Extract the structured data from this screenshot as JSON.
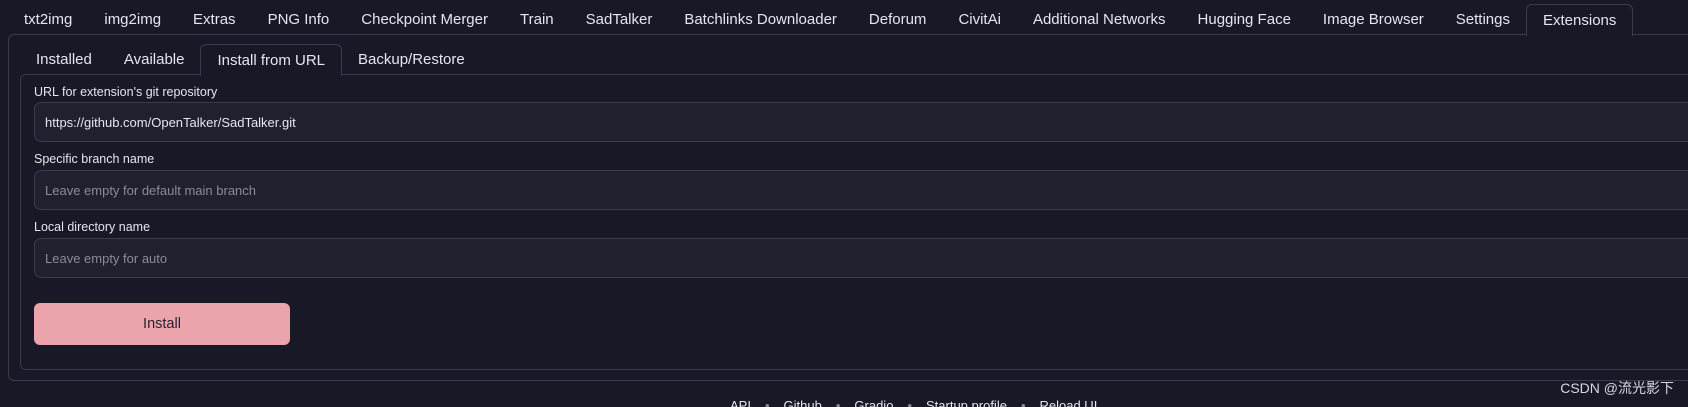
{
  "top_tabs": [
    {
      "label": "txt2img"
    },
    {
      "label": "img2img"
    },
    {
      "label": "Extras"
    },
    {
      "label": "PNG Info"
    },
    {
      "label": "Checkpoint Merger"
    },
    {
      "label": "Train"
    },
    {
      "label": "SadTalker"
    },
    {
      "label": "Batchlinks Downloader"
    },
    {
      "label": "Deforum"
    },
    {
      "label": "CivitAi"
    },
    {
      "label": "Additional Networks"
    },
    {
      "label": "Hugging Face"
    },
    {
      "label": "Image Browser"
    },
    {
      "label": "Settings"
    },
    {
      "label": "Extensions"
    }
  ],
  "active_top_tab": "Extensions",
  "inner_tabs": [
    {
      "label": "Installed"
    },
    {
      "label": "Available"
    },
    {
      "label": "Install from URL"
    },
    {
      "label": "Backup/Restore"
    }
  ],
  "active_inner_tab": "Install from URL",
  "form": {
    "url": {
      "label": "URL for extension's git repository",
      "value": "https://github.com/OpenTalker/SadTalker.git"
    },
    "branch": {
      "label": "Specific branch name",
      "placeholder": "Leave empty for default main branch"
    },
    "directory": {
      "label": "Local directory name",
      "placeholder": "Leave empty for auto"
    },
    "install_label": "Install"
  },
  "footer": {
    "links": [
      "API",
      "Github",
      "Gradio",
      "Startup profile",
      "Reload UI"
    ],
    "separator": "•"
  },
  "watermark": "CSDN @流光影下",
  "colors": {
    "background": "#181826",
    "border": "#3b3b4f",
    "input_bg": "#20202f",
    "accent": "#eba4ac"
  }
}
